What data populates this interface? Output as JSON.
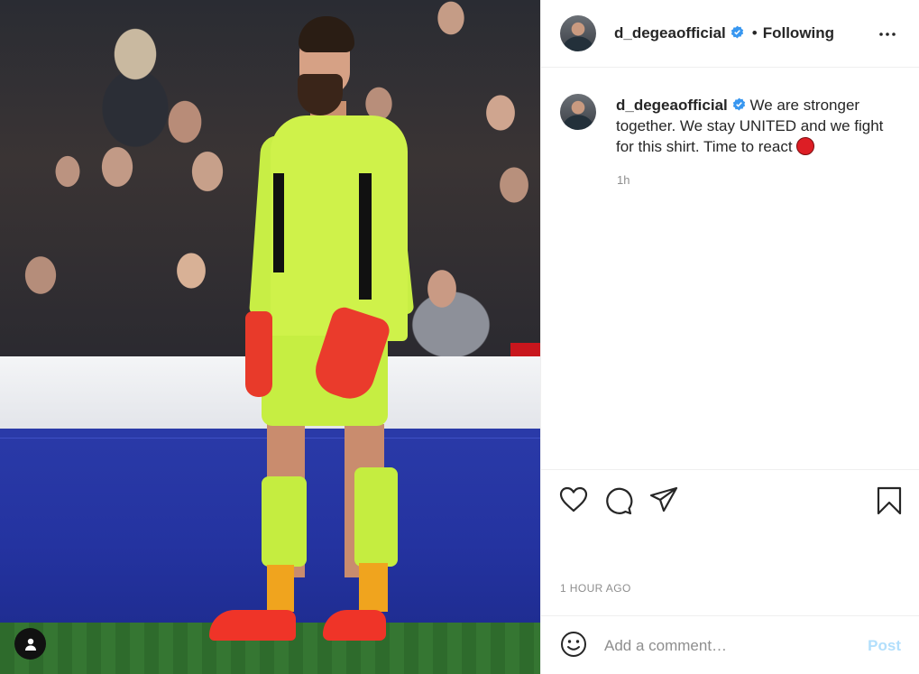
{
  "post": {
    "author": "d_degeaofficial",
    "verified": true,
    "follow_state": "Following",
    "caption": "We are stronger together. We stay UNITED and we fight for this shirt. Time to react",
    "caption_emoji": "red-circle-emoji",
    "relative_time": "1h",
    "timestamp": "1 HOUR AGO"
  },
  "comment": {
    "placeholder": "Add a comment…",
    "post_label": "Post"
  },
  "icons": {
    "more": "more-options-icon",
    "like": "heart-icon",
    "comment": "comment-icon",
    "share": "share-icon",
    "save": "bookmark-icon",
    "emoji": "emoji-icon",
    "user_tag": "user-tag-icon"
  },
  "colors": {
    "verified_blue": "#3897f0",
    "post_button_disabled": "#b2dffc",
    "muted_text": "#8e8e8e",
    "red_circle": "#dd1e25"
  }
}
